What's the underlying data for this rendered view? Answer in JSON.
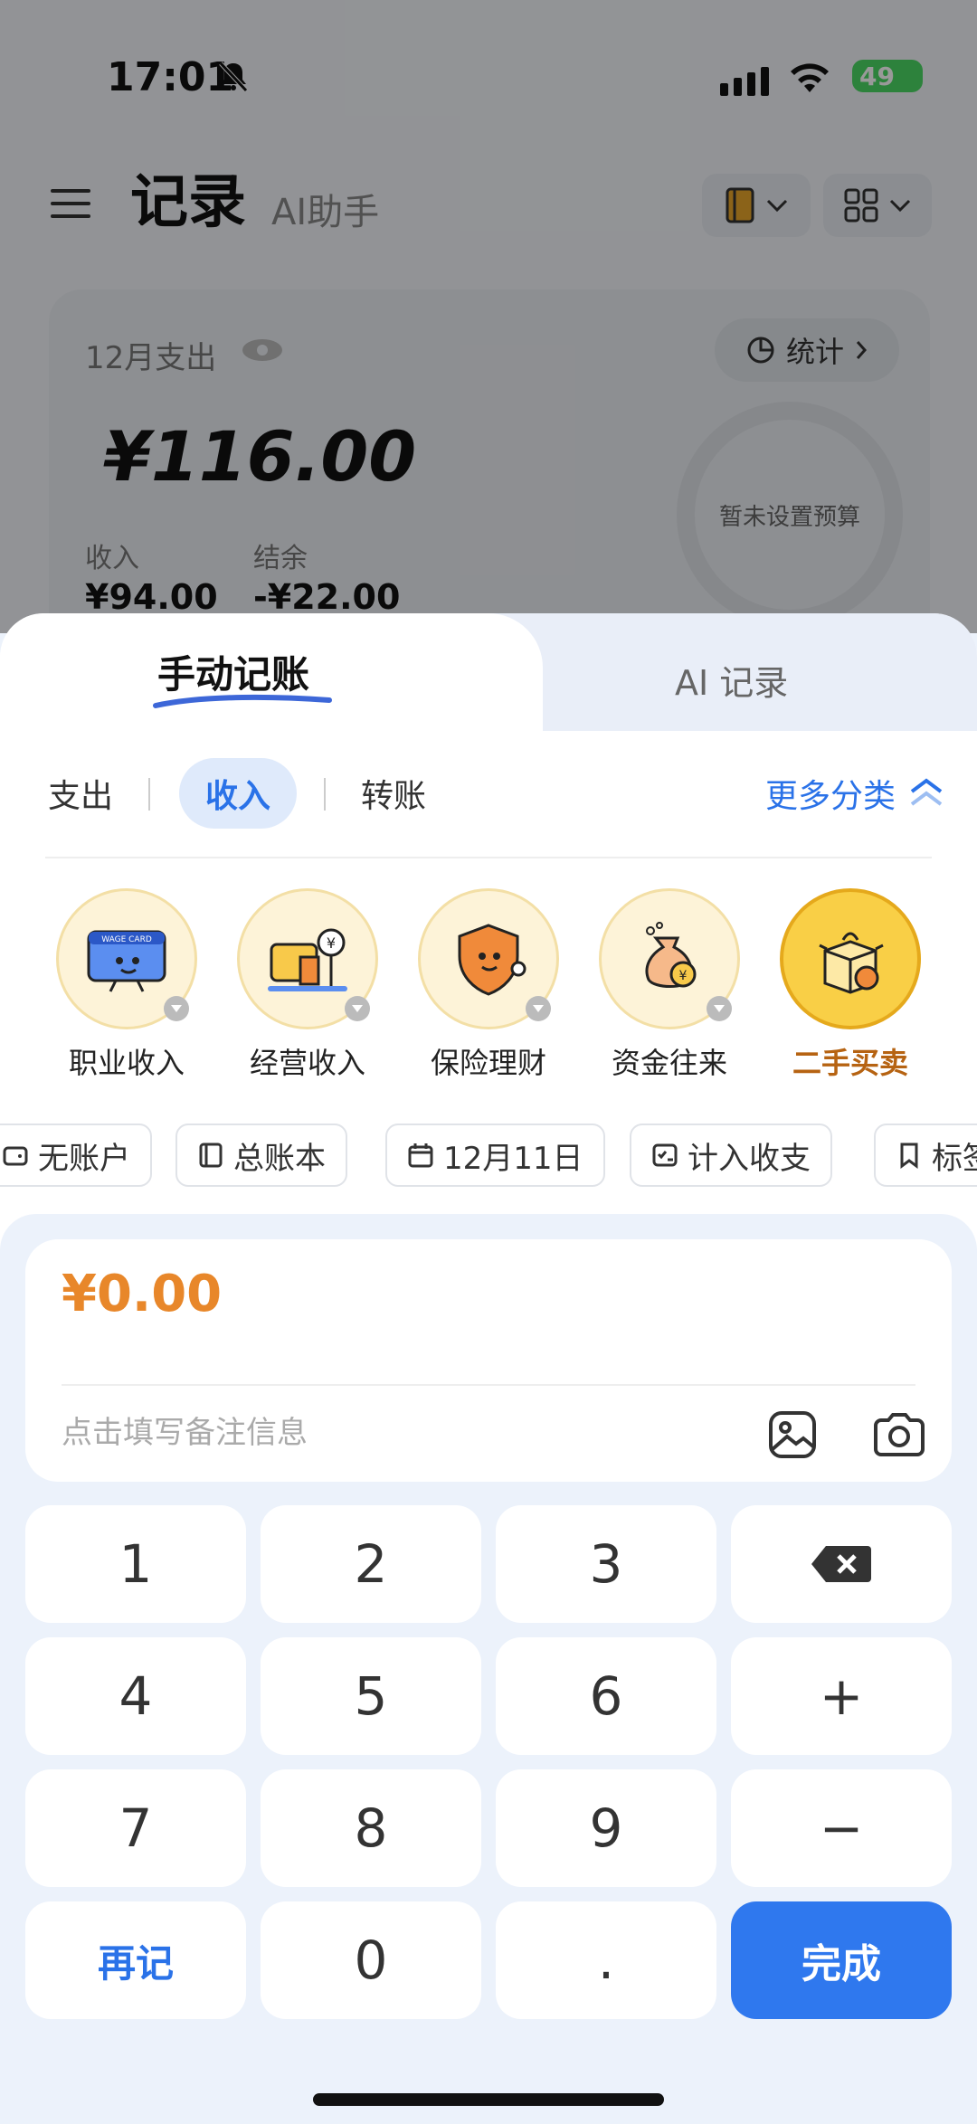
{
  "status_bar": {
    "time": "17:01",
    "battery": "49"
  },
  "header": {
    "title": "记录",
    "subtitle": "AI助手"
  },
  "summary": {
    "month_label": "12月支出",
    "stats_label": "统计",
    "amount": "¥116.00",
    "budget_text": "暂未设置预算",
    "income_label": "收入",
    "income_value": "¥94.00",
    "balance_label": "结余",
    "balance_value": "-¥22.00"
  },
  "sheet_tabs": {
    "manual": "手动记账",
    "ai": "AI 记录"
  },
  "types": {
    "expense": "支出",
    "income": "收入",
    "transfer": "转账",
    "more": "更多分类"
  },
  "categories": [
    {
      "name": "职业收入",
      "icon": "wage-card-icon"
    },
    {
      "name": "经营收入",
      "icon": "shop-icon"
    },
    {
      "name": "保险理财",
      "icon": "shield-icon"
    },
    {
      "name": "资金往来",
      "icon": "money-bag-icon"
    },
    {
      "name": "二手买卖",
      "icon": "box-icon",
      "selected": true
    }
  ],
  "chips": {
    "account": "无账户",
    "ledger": "总账本",
    "date": "12月11日",
    "count": "计入收支",
    "tag": "标签"
  },
  "entry": {
    "amount": "¥0.00",
    "note_placeholder": "点击填写备注信息"
  },
  "keys": {
    "k1": "1",
    "k2": "2",
    "k3": "3",
    "k4": "4",
    "k5": "5",
    "k6": "6",
    "plus": "+",
    "k7": "7",
    "k8": "8",
    "k9": "9",
    "minus": "−",
    "again": "再记",
    "k0": "0",
    "dot": ".",
    "done": "完成"
  },
  "colors": {
    "accent": "#2f78ee",
    "amount": "#e8872a",
    "selected_cat": "#f9cf46"
  }
}
